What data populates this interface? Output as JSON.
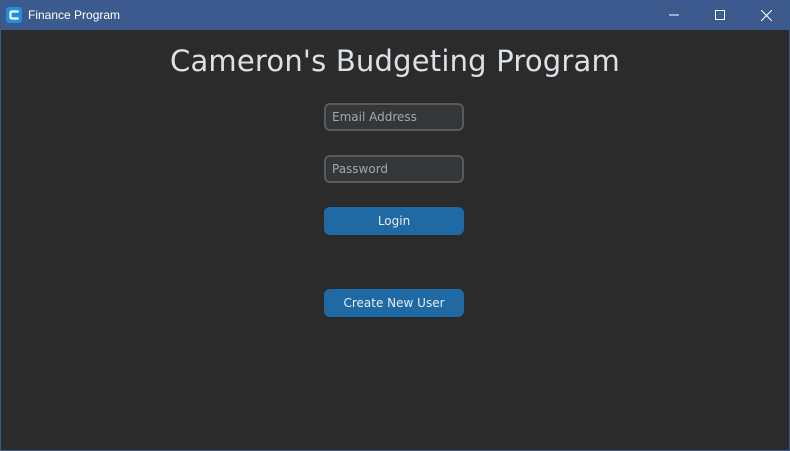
{
  "window": {
    "title": "Finance Program",
    "icon": "app-c-logo-icon",
    "controls": [
      "minimize-icon",
      "maximize-icon",
      "close-icon"
    ]
  },
  "main": {
    "heading": "Cameron's Budgeting Program",
    "email": {
      "placeholder": "Email Address",
      "value": ""
    },
    "password": {
      "placeholder": "Password",
      "value": ""
    },
    "login_label": "Login",
    "create_user_label": "Create New User"
  },
  "colors": {
    "titlebar": "#3c5a8e",
    "background": "#2b2b2b",
    "button": "#1f6aa5",
    "field_bg": "#343638",
    "field_border": "#565b5e"
  }
}
